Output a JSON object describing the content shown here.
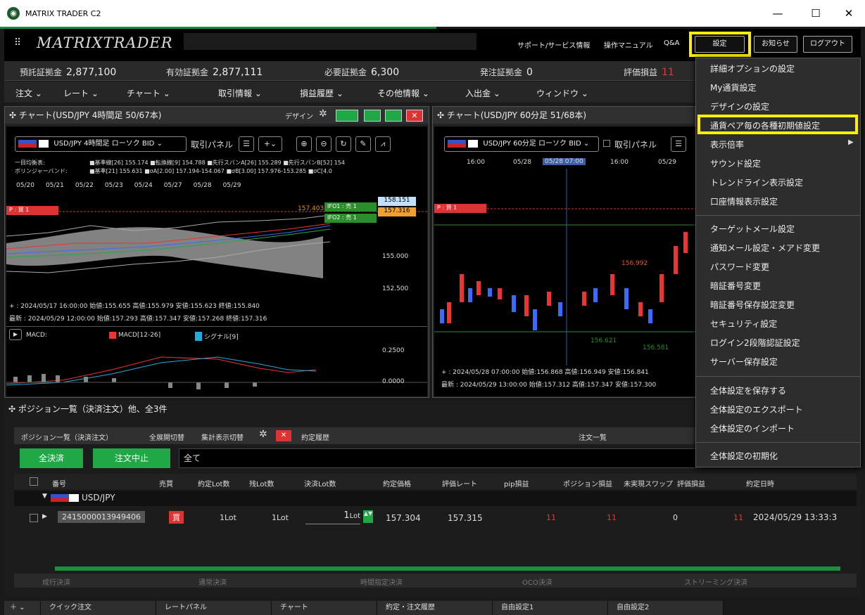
{
  "window": {
    "title": "MATRIX TRADER C2",
    "minimize": "—",
    "maximize": "☐",
    "close": "✕"
  },
  "header": {
    "brand": "MATRIXTRADER",
    "links": [
      "サポート/サービス情報",
      "操作マニュアル",
      "Q&A"
    ],
    "settings_btn": "設定",
    "news_btn": "お知らせ",
    "logout_btn": "ログアウト"
  },
  "status": {
    "deposit_label": "預託証拠金",
    "deposit": "2,877,100",
    "effective_label": "有効証拠金",
    "effective": "2,877,111",
    "required_label": "必要証拠金",
    "required": "6,300",
    "order_label": "発注証拠金",
    "order": "0",
    "pl_label": "評価損益",
    "pl": "11"
  },
  "menu": [
    "注文 ⌄",
    "レート ⌄",
    "チャート ⌄",
    "取引情報 ⌄",
    "損益履歴 ⌄",
    "その他情報 ⌄",
    "入出金 ⌄",
    "ウィンドウ ⌄"
  ],
  "chart1": {
    "title": "✣ チャート(USD/JPY 4時間足 50/67本)",
    "design": "デザイン",
    "pair_select": "USD/JPY 4時間足 ローソク BID",
    "trade_panel": "取引パネル",
    "ichimoku_label": "一目均衡表:",
    "ichimoku_vals": "■基準線[26] 155.174  ■転換線[9] 154.788  ■先行スパンA[26] 155.289  ■先行スパンB[52] 154",
    "bb_label": "ボリンジャーバンド:",
    "bb_vals": "■基準[21] 155.631  ■σA[2.00] 157.194-154.067  ■σB[3.00] 157.976-153.285  ■σC[4.0",
    "dates": [
      "05/20",
      "05/21",
      "05/22",
      "05/23",
      "05/24",
      "05/27",
      "05/28",
      "05/29"
    ],
    "prices": [
      "158.151",
      "157.316",
      "155.000",
      "152.500",
      "157.403"
    ],
    "ifo1": "IFO1 : 売   1",
    "ifo2": "IFO2 : 売   1",
    "p_label": "P : 買    1",
    "cursor_info": "+ : 2024/05/17 16:00:00 始値:155.655 高値:155.979 安値:155.623 終値:155.840",
    "latest_info": "最新 : 2024/05/29 12:00:00 始値:157.293 高値:157.347 安値:157.268 終値:157.316",
    "macd_label": "MACD:",
    "macd_series": "MACD[12-26]",
    "signal_series": "シグナル[9]",
    "macd_levels": [
      "0.2500",
      "0.0000"
    ]
  },
  "chart2": {
    "title": "✣ チャート(USD/JPY 60分足 51/68本)",
    "pair_select": "USD/JPY 60分足 ローソク BID",
    "trade_panel": "取引パネル",
    "times": [
      "16:00",
      "05/28",
      "05/28 07:00",
      "16:00",
      "05/29"
    ],
    "p_label": "P : 買    1",
    "labels": [
      "156.992",
      "156.621",
      "156.581"
    ],
    "cursor_info": "+ : 2024/05/28 07:00:00 始値:156.868 高値:156.949 安値:156.841",
    "latest_info": "最新 : 2024/05/29 13:00:00 始値:157.312 高値:157.347 安値:157.300"
  },
  "dropdown": [
    "詳細オプションの設定",
    "My通貨設定",
    "デザインの設定",
    "通貨ペア毎の各種初期値設定",
    "表示倍率",
    "サウンド設定",
    "トレンドライン表示設定",
    "口座情報表示設定",
    "ターゲットメール設定",
    "通知メール設定・メアド変更",
    "パスワード変更",
    "暗証番号変更",
    "暗証番号保存設定変更",
    "セキュリティ設定",
    "ログイン2段階認証設定",
    "サーバー保存設定",
    "全体設定を保存する",
    "全体設定のエクスポート",
    "全体設定のインポート",
    "全体設定の初期化"
  ],
  "positions": {
    "panel_title": "✣ ポジション一覧（決済注文）他、全3件",
    "tab": "ポジション一覧（決済注文）",
    "expand": "全展開切替",
    "summary": "集計表示切替",
    "history_tab": "約定履歴",
    "orders_tab": "注文一覧",
    "settle_all": "全決済",
    "cancel_orders": "注文中止",
    "filter": "全て",
    "columns": [
      "番号",
      "売買",
      "約定Lot数",
      "残Lot数",
      "決済Lot数",
      "約定価格",
      "評価レート",
      "pip損益",
      "ポジション損益",
      "未実現スワップ",
      "評価損益",
      "約定日時"
    ],
    "group": "USD/JPY",
    "row": {
      "id": "2415000013949406",
      "side": "買",
      "lot": "1Lot",
      "remain": "1Lot",
      "settle": "1",
      "settle_unit": "Lot",
      "price": "157.304",
      "rate": "157.315",
      "pip": "11",
      "pos_pl": "11",
      "swap": "0",
      "pl": "11",
      "date": "2024/05/29 13:33:3"
    },
    "order_types": [
      "成行決済",
      "通常決済",
      "時間指定決済",
      "OCO決済",
      "ストリーミング決済"
    ]
  },
  "bottom_tabs": [
    "クイック注文",
    "レートパネル",
    "チャート",
    "約定・注文履歴",
    "自由設定1",
    "自由設定2"
  ]
}
